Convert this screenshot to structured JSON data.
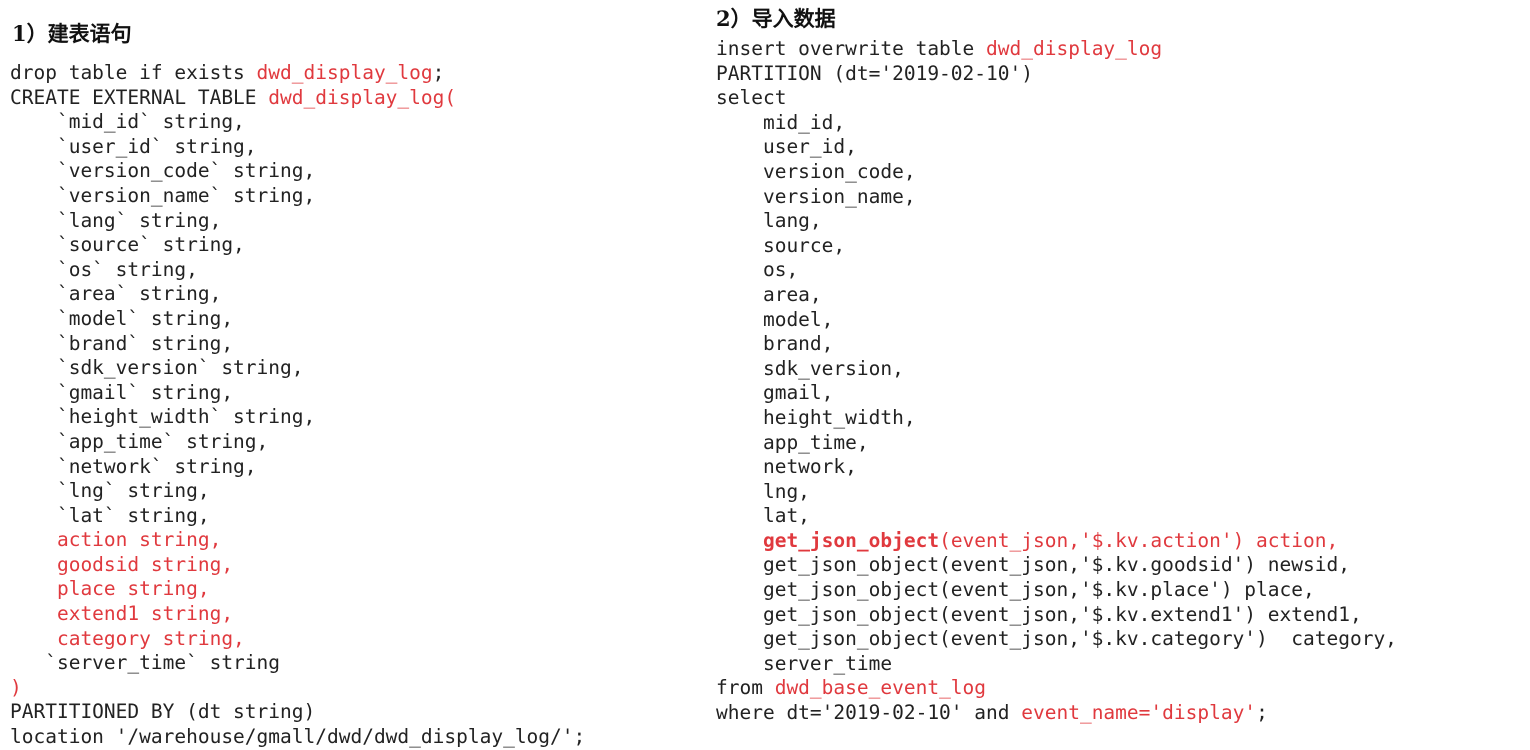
{
  "colors": {
    "text": "#222222",
    "highlight": "#e0393e",
    "background": "#ffffff"
  },
  "left": {
    "heading": "1）建表语句",
    "lines": [
      [
        {
          "t": "drop table if exists "
        },
        {
          "t": "dwd_display_log",
          "c": "red"
        },
        {
          "t": ";"
        }
      ],
      [
        {
          "t": "CREATE EXTERNAL TABLE "
        },
        {
          "t": "dwd_display_log(",
          "c": "red"
        }
      ],
      [
        {
          "t": "    `mid_id` string,"
        }
      ],
      [
        {
          "t": "    `user_id` string,"
        }
      ],
      [
        {
          "t": "    `version_code` string,"
        }
      ],
      [
        {
          "t": "    `version_name` string,"
        }
      ],
      [
        {
          "t": "    `lang` string,"
        }
      ],
      [
        {
          "t": "    `source` string,"
        }
      ],
      [
        {
          "t": "    `os` string,"
        }
      ],
      [
        {
          "t": "    `area` string,"
        }
      ],
      [
        {
          "t": "    `model` string,"
        }
      ],
      [
        {
          "t": "    `brand` string,"
        }
      ],
      [
        {
          "t": "    `sdk_version` string,"
        }
      ],
      [
        {
          "t": "    `gmail` string,"
        }
      ],
      [
        {
          "t": "    `height_width` string,"
        }
      ],
      [
        {
          "t": "    `app_time` string,"
        }
      ],
      [
        {
          "t": "    `network` string,"
        }
      ],
      [
        {
          "t": "    `lng` string,"
        }
      ],
      [
        {
          "t": "    `lat` string,"
        }
      ],
      [
        {
          "t": "    action string,",
          "c": "red"
        }
      ],
      [
        {
          "t": "    goodsid string,",
          "c": "red"
        }
      ],
      [
        {
          "t": "    place string,",
          "c": "red"
        }
      ],
      [
        {
          "t": "    extend1 string,",
          "c": "red"
        }
      ],
      [
        {
          "t": "    category string,",
          "c": "red"
        }
      ],
      [
        {
          "t": "   `server_time` string"
        }
      ],
      [
        {
          "t": ")",
          "c": "red"
        }
      ],
      [
        {
          "t": "PARTITIONED BY (dt string)"
        }
      ],
      [
        {
          "t": "location '/warehouse/gmall/dwd/dwd_display_log/';"
        }
      ]
    ]
  },
  "right": {
    "heading": "2）导入数据",
    "lines": [
      [
        {
          "t": "insert overwrite table "
        },
        {
          "t": "dwd_display_log",
          "c": "red"
        }
      ],
      [
        {
          "t": "PARTITION (dt='2019-02-10')"
        }
      ],
      [
        {
          "t": "select"
        }
      ],
      [
        {
          "t": "    mid_id,"
        }
      ],
      [
        {
          "t": "    user_id,"
        }
      ],
      [
        {
          "t": "    version_code,"
        }
      ],
      [
        {
          "t": "    version_name,"
        }
      ],
      [
        {
          "t": "    lang,"
        }
      ],
      [
        {
          "t": "    source,"
        }
      ],
      [
        {
          "t": "    os,"
        }
      ],
      [
        {
          "t": "    area,"
        }
      ],
      [
        {
          "t": "    model,"
        }
      ],
      [
        {
          "t": "    brand,"
        }
      ],
      [
        {
          "t": "    sdk_version,"
        }
      ],
      [
        {
          "t": "    gmail,"
        }
      ],
      [
        {
          "t": "    height_width,"
        }
      ],
      [
        {
          "t": "    app_time,"
        }
      ],
      [
        {
          "t": "    network,"
        }
      ],
      [
        {
          "t": "    lng,"
        }
      ],
      [
        {
          "t": "    lat,"
        }
      ],
      [
        {
          "t": "    "
        },
        {
          "t": "get_json_object",
          "c": "red",
          "b": true
        },
        {
          "t": "(event_json,'$.kv.action') action,",
          "c": "red"
        }
      ],
      [
        {
          "t": "    get_json_object(event_json,'$.kv.goodsid') newsid,"
        }
      ],
      [
        {
          "t": "    get_json_object(event_json,'$.kv.place') place,"
        }
      ],
      [
        {
          "t": "    get_json_object(event_json,'$.kv.extend1') extend1,"
        }
      ],
      [
        {
          "t": "    get_json_object(event_json,'$.kv.category')  category,"
        }
      ],
      [
        {
          "t": "    server_time"
        }
      ],
      [
        {
          "t": "from "
        },
        {
          "t": "dwd_base_event_log",
          "c": "red"
        }
      ],
      [
        {
          "t": "where dt='2019-02-10' and "
        },
        {
          "t": "event_name='display'",
          "c": "red"
        },
        {
          "t": ";"
        }
      ]
    ]
  }
}
